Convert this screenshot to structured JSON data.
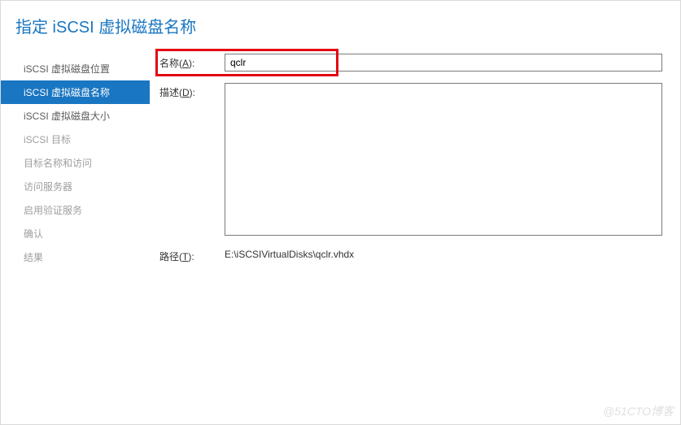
{
  "header": {
    "title": "指定 iSCSI 虚拟磁盘名称"
  },
  "sidebar": {
    "items": [
      {
        "label": "iSCSI 虚拟磁盘位置",
        "state": "enabled"
      },
      {
        "label": "iSCSI 虚拟磁盘名称",
        "state": "active"
      },
      {
        "label": "iSCSI 虚拟磁盘大小",
        "state": "enabled"
      },
      {
        "label": "iSCSI 目标",
        "state": "disabled"
      },
      {
        "label": "目标名称和访问",
        "state": "disabled"
      },
      {
        "label": "访问服务器",
        "state": "disabled"
      },
      {
        "label": "启用验证服务",
        "state": "disabled"
      },
      {
        "label": "确认",
        "state": "disabled"
      },
      {
        "label": "结果",
        "state": "disabled"
      }
    ]
  },
  "form": {
    "name_label_pre": "名称(",
    "name_label_hot": "A",
    "name_label_post": "):",
    "name_value": "qclr",
    "desc_label_pre": "描述(",
    "desc_label_hot": "D",
    "desc_label_post": "):",
    "desc_value": "",
    "path_label_pre": "路径(",
    "path_label_hot": "T",
    "path_label_post": "):",
    "path_value": "E:\\iSCSIVirtualDisks\\qclr.vhdx"
  },
  "watermark": "@51CTO博客"
}
